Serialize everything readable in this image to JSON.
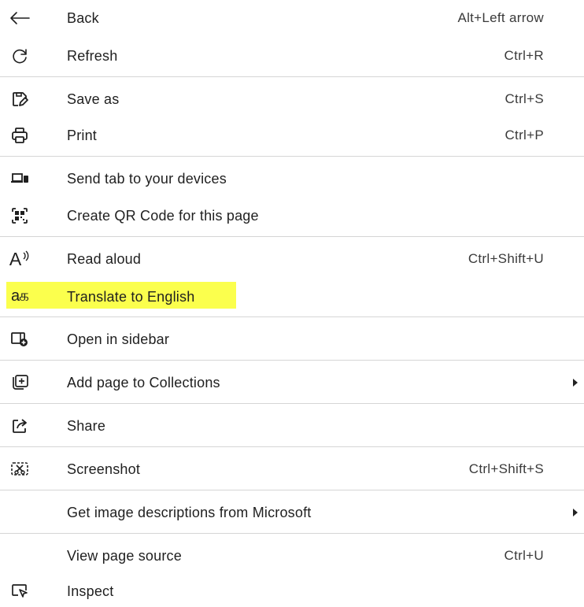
{
  "menu": {
    "items": [
      {
        "label": "Back",
        "shortcut": "Alt+Left arrow",
        "icon": "back-arrow-icon"
      },
      {
        "label": "Refresh",
        "shortcut": "Ctrl+R",
        "icon": "refresh-icon"
      },
      {
        "label": "Save as",
        "shortcut": "Ctrl+S",
        "icon": "save-as-icon"
      },
      {
        "label": "Print",
        "shortcut": "Ctrl+P",
        "icon": "print-icon"
      },
      {
        "label": "Send tab to your devices",
        "shortcut": "",
        "icon": "devices-icon"
      },
      {
        "label": "Create QR Code for this page",
        "shortcut": "",
        "icon": "qr-code-icon"
      },
      {
        "label": "Read aloud",
        "shortcut": "Ctrl+Shift+U",
        "icon": "read-aloud-icon"
      },
      {
        "label": "Translate to English",
        "shortcut": "",
        "icon": "translate-icon",
        "icon_text": "aக",
        "highlighted": true,
        "highlight_color": "#fbff4d"
      },
      {
        "label": "Open in sidebar",
        "shortcut": "",
        "icon": "open-in-sidebar-icon"
      },
      {
        "label": "Add page to Collections",
        "shortcut": "",
        "icon": "collections-icon",
        "submenu": true
      },
      {
        "label": "Share",
        "shortcut": "",
        "icon": "share-icon"
      },
      {
        "label": "Screenshot",
        "shortcut": "Ctrl+Shift+S",
        "icon": "screenshot-icon"
      },
      {
        "label": "Get image descriptions from Microsoft",
        "shortcut": "",
        "icon": "",
        "submenu": true
      },
      {
        "label": "View page source",
        "shortcut": "Ctrl+U",
        "icon": ""
      },
      {
        "label": "Inspect",
        "shortcut": "",
        "icon": "inspect-icon"
      }
    ],
    "read_aloud_icon_text": "A"
  }
}
